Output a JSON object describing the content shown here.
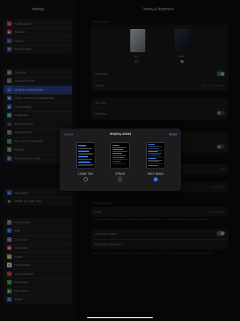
{
  "status": {
    "time": "16:02",
    "date": "Tue 29 Oct",
    "battery": "85% 65%"
  },
  "sidebar": {
    "title": "Settings",
    "groups": [
      [
        {
          "label": "Notifications",
          "icon": "bell-icon",
          "color": "#d93b3b"
        },
        {
          "label": "Sounds",
          "icon": "speaker-icon",
          "color": "#d9395a"
        },
        {
          "label": "Focus",
          "icon": "moon-icon",
          "color": "#5a4fc9"
        },
        {
          "label": "Screen Time",
          "icon": "hourglass-icon",
          "color": "#5a4fc9"
        }
      ],
      [
        {
          "label": "General",
          "icon": "gear-icon",
          "color": "#7d7d82"
        },
        {
          "label": "Control Centre",
          "icon": "switches-icon",
          "color": "#7d7d82"
        },
        {
          "label": "Display & Brightness",
          "icon": "text-size-icon",
          "color": "#2f6ddb",
          "selected": true
        },
        {
          "label": "Home Screen & Multitasking",
          "icon": "grid-icon",
          "color": "#2f6ddb"
        },
        {
          "label": "Accessibility",
          "icon": "accessibility-icon",
          "color": "#2f6ddb"
        },
        {
          "label": "Wallpaper",
          "icon": "flower-icon",
          "color": "#2fa6c9"
        },
        {
          "label": "Siri & Search",
          "icon": "siri-icon",
          "color": "#3a3a3e"
        },
        {
          "label": "Apple Pencil",
          "icon": "pencil-icon",
          "color": "#7d7d82"
        },
        {
          "label": "Face ID & Passcode",
          "icon": "face-id-icon",
          "color": "#3aa14b"
        },
        {
          "label": "Battery",
          "icon": "battery-icon",
          "color": "#3aa14b"
        },
        {
          "label": "Privacy & Security",
          "icon": "hand-icon",
          "color": "#2f6ddb"
        }
      ],
      [
        {
          "label": "App Store",
          "icon": "app-store-icon",
          "color": "#2f6ddb"
        },
        {
          "label": "Wallet & Apple Pay",
          "icon": "wallet-icon",
          "color": "#222226"
        }
      ],
      [
        {
          "label": "Passwords",
          "icon": "key-icon",
          "color": "#7d7d82"
        },
        {
          "label": "Mail",
          "icon": "envelope-icon",
          "color": "#2f6ddb"
        },
        {
          "label": "Contacts",
          "icon": "contacts-icon",
          "color": "#7d7d82"
        },
        {
          "label": "Calendar",
          "icon": "calendar-icon",
          "color": "#d93b3b"
        },
        {
          "label": "Notes",
          "icon": "notes-icon",
          "color": "#d9b13a"
        },
        {
          "label": "Reminders",
          "icon": "list-icon",
          "color": "#e5e5e8"
        },
        {
          "label": "Voice Memos",
          "icon": "waveform-icon",
          "color": "#d93b3b"
        },
        {
          "label": "Messages",
          "icon": "message-icon",
          "color": "#3aa14b"
        },
        {
          "label": "FaceTime",
          "icon": "video-icon",
          "color": "#3aa14b"
        },
        {
          "label": "Safari",
          "icon": "compass-icon",
          "color": "#2f6ddb"
        }
      ]
    ]
  },
  "detail": {
    "title": "Display & Brightness",
    "appearance_label": "APPEARANCE",
    "light_label": "Light",
    "dark_label": "Dark",
    "automatic_label": "Automatic",
    "options_label": "Options",
    "options_value": "Dark Until Sunrise",
    "text_size_label": "Text Size",
    "bold_text_label": "Bold Text",
    "autolock_value": "Off",
    "minutes_value": "2 minutes",
    "display_zoom_label": "DISPLAY ZOOM",
    "view_label": "View",
    "view_value": "More Space",
    "zoom_footer": "Choose a view for iPad. Larger Text shows larger controls. Default shows more content. More Space shows even more content.",
    "reference_mode_label": "Reference Mode",
    "fine_tune_label": "Fine-Tune Calibration",
    "reference_footer": "Use this mode for colour-critical workflows in a controlled viewing environment. Turning on Reference Mode may affect battery life."
  },
  "modal": {
    "cancel": "Cancel",
    "title": "Display Zoom",
    "done": "Done",
    "options": [
      {
        "label": "Larger Text",
        "selected": false
      },
      {
        "label": "Default",
        "selected": false
      },
      {
        "label": "More Space",
        "selected": true
      }
    ]
  },
  "colors": {
    "accent": "#3a78e8",
    "selection": "#2e3e8a",
    "toggle_on": "#2f7a3a"
  }
}
